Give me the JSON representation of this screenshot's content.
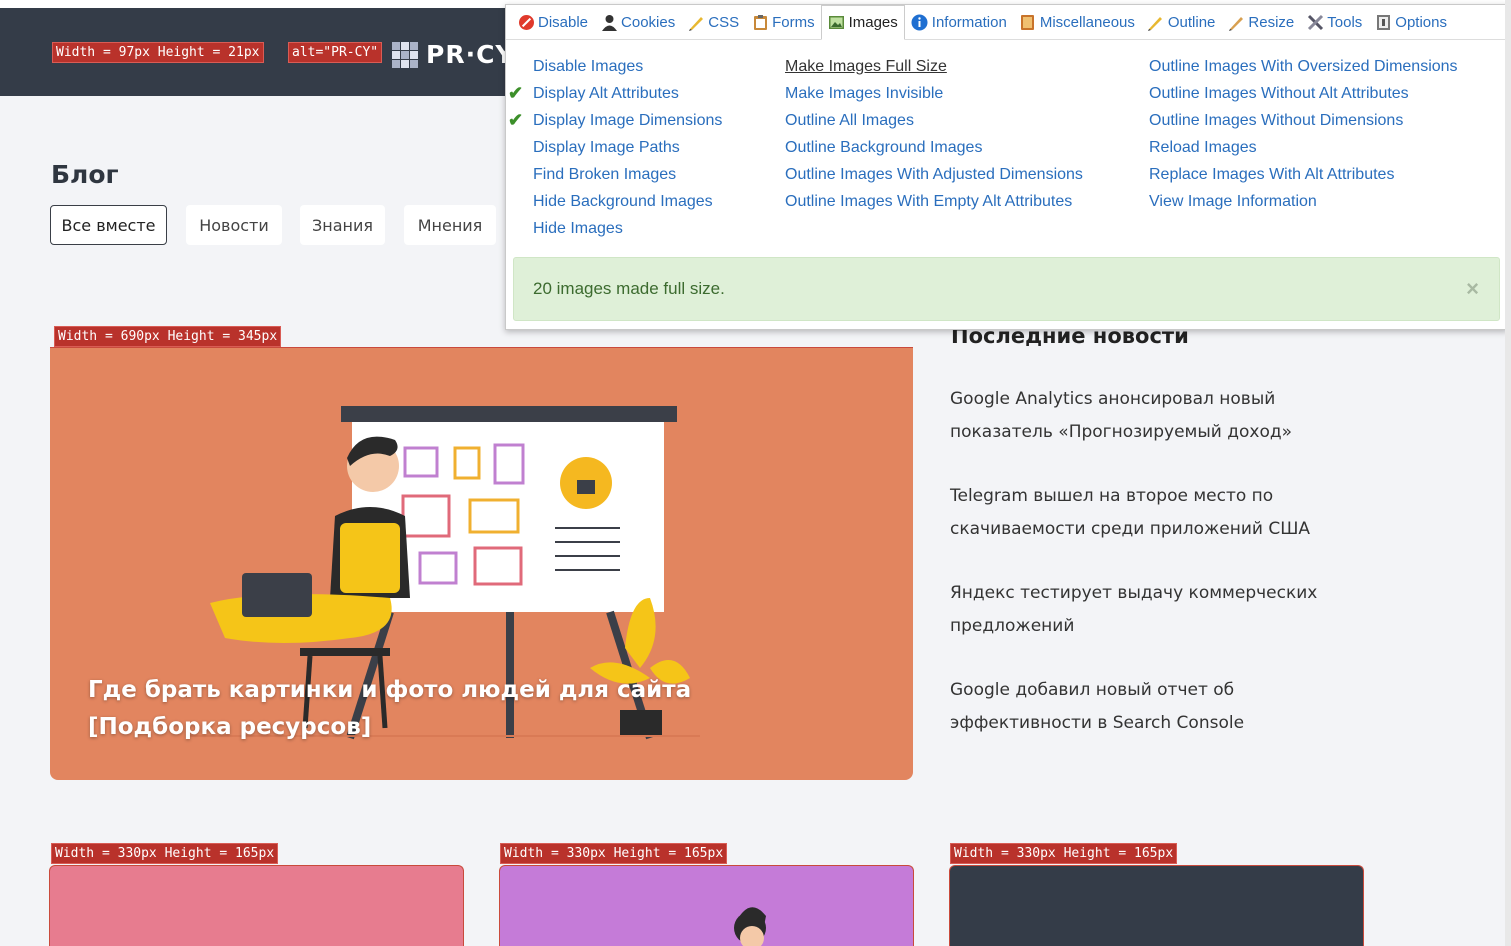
{
  "header": {
    "dim_label": "Width = 97px Height = 21px",
    "alt_label": "alt=\"PR-CY\"",
    "logo_text": "PR·CY"
  },
  "blog": {
    "title": "Блог",
    "filters": [
      "Все вместе",
      "Новости",
      "Знания",
      "Мнения"
    ]
  },
  "hero": {
    "dim_label": "Width = 690px Height = 345px",
    "caption": "Где брать картинки и фото людей для сайта [Подборка ресурсов]",
    "color": "#e2855f"
  },
  "news": {
    "title": "Последние новости",
    "items": [
      "Google Analytics анонсировал новый показатель «Прогнозируемый доход»",
      "Telegram вышел на второе место по скачиваемости среди приложений США",
      "Яндекс тестирует выдачу коммерческих предложений",
      "Google добавил новый отчет об эффективности в Search Console"
    ]
  },
  "thumbs": [
    {
      "dim_label": "Width = 330px Height = 165px",
      "color": "#e77c8f"
    },
    {
      "dim_label": "Width = 330px Height = 165px",
      "color": "#c57bd8"
    },
    {
      "dim_label": "Width = 330px Height = 165px",
      "color": "#343c48"
    }
  ],
  "toolbar": {
    "tabs": [
      {
        "label": "Disable",
        "icon": "disable-icon"
      },
      {
        "label": "Cookies",
        "icon": "cookies-icon"
      },
      {
        "label": "CSS",
        "icon": "css-icon"
      },
      {
        "label": "Forms",
        "icon": "forms-icon"
      },
      {
        "label": "Images",
        "icon": "images-icon",
        "active": true
      },
      {
        "label": "Information",
        "icon": "information-icon"
      },
      {
        "label": "Miscellaneous",
        "icon": "miscellaneous-icon"
      },
      {
        "label": "Outline",
        "icon": "outline-icon"
      },
      {
        "label": "Resize",
        "icon": "resize-icon"
      },
      {
        "label": "Tools",
        "icon": "tools-icon"
      },
      {
        "label": "Options",
        "icon": "options-icon"
      }
    ],
    "col1": [
      "Disable Images",
      "Display Alt Attributes",
      "Display Image Dimensions",
      "Display Image Paths",
      "Find Broken Images",
      "Hide Background Images",
      "Hide Images"
    ],
    "col1_checked": [
      false,
      true,
      true,
      false,
      false,
      false,
      false
    ],
    "col2": [
      "Make Images Full Size",
      "Make Images Invisible",
      "Outline All Images",
      "Outline Background Images",
      "Outline Images With Adjusted Dimensions",
      "Outline Images With Empty Alt Attributes"
    ],
    "col3": [
      "Outline Images With Oversized Dimensions",
      "Outline Images Without Alt Attributes",
      "Outline Images Without Dimensions",
      "Reload Images",
      "Replace Images With Alt Attributes",
      "View Image Information"
    ],
    "alert": "20 images made full size.",
    "alert_close": "×"
  }
}
